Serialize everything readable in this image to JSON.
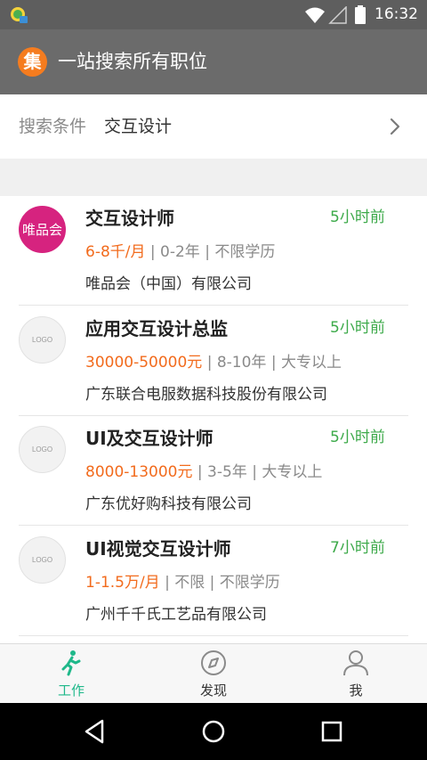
{
  "status_bar": {
    "time": "16:32",
    "icons": [
      "notification-app-icon",
      "wifi-icon",
      "signal-icon",
      "battery-icon"
    ]
  },
  "app_bar": {
    "logo_char": "集",
    "title": "一站搜索所有职位",
    "colors": {
      "background": "#6b6b6b",
      "logo": "#f57c1f"
    }
  },
  "search": {
    "label": "搜索条件",
    "value": "交互设计"
  },
  "jobs": [
    {
      "title": "交互设计师",
      "time": "5小时前",
      "salary": "6-8千/月",
      "details": " | 0-2年 | 不限学历",
      "company": "唯品会（中国）有限公司",
      "logo_text": "唯品会"
    },
    {
      "title": "应用交互设计总监",
      "time": "5小时前",
      "salary": "30000-50000元",
      "details": " | 8-10年 | 大专以上",
      "company": "广东联合电服数据科技股份有限公司",
      "logo_text": "LOGO"
    },
    {
      "title": "UI及交互设计师",
      "time": "5小时前",
      "salary": "8000-13000元",
      "details": " | 3-5年 | 大专以上",
      "company": "广东优好购科技有限公司",
      "logo_text": "LOGO"
    },
    {
      "title": "UI视觉交互设计师",
      "time": "7小时前",
      "salary": "1-1.5万/月",
      "details": " | 不限 | 不限学历",
      "company": "广州千千氏工艺品有限公司",
      "logo_text": "LOGO"
    }
  ],
  "tabs": [
    {
      "label": "工作",
      "icon": "walking-person-icon",
      "active": true
    },
    {
      "label": "发现",
      "icon": "compass-icon",
      "active": false
    },
    {
      "label": "我",
      "icon": "person-icon",
      "active": false
    }
  ],
  "colors": {
    "accent_green": "#1fb88a",
    "time_green": "#3daa4a",
    "salary_orange": "#f26b1d"
  },
  "nav_bar": {
    "icons": [
      "back-icon",
      "home-icon",
      "recents-icon"
    ]
  }
}
